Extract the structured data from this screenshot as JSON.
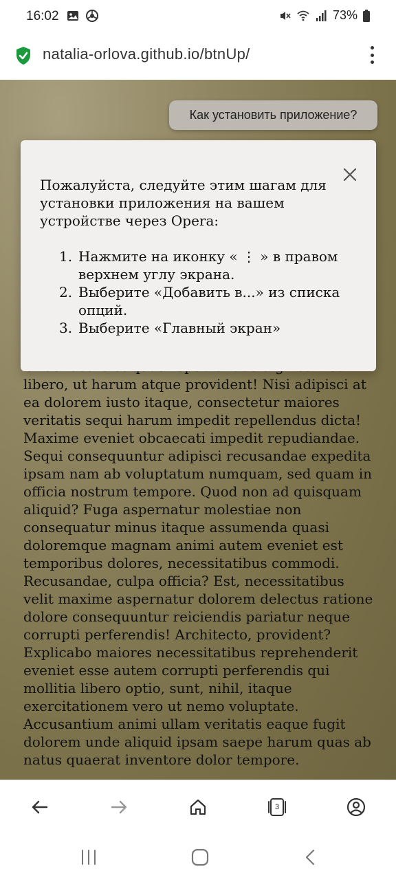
{
  "status_bar": {
    "time": "16:02",
    "battery": "73%",
    "icons_left": [
      "gallery-icon",
      "chrome-icon"
    ],
    "icons_right": [
      "mute-icon",
      "wifi-icon",
      "signal-icon",
      "battery-icon"
    ]
  },
  "address_bar": {
    "url": "natalia-orlova.github.io/btnUp/",
    "security_icon": "shield-check-icon",
    "menu_icon": "vertical-dots-icon"
  },
  "page": {
    "install_button_label": "Как установить приложение?",
    "body_text": "Unde facere et quae repudiandae dignissimos libero, ut harum atque provident! Nisi adipisci at ea dolorem iusto itaque, consectetur maiores veritatis sequi harum impedit repellendus dicta! Maxime eveniet obcaecati impedit repudiandae. Sequi consequuntur adipisci recusandae expedita ipsam nam ab voluptatum numquam, sed quam in officia nostrum tempore. Quod non ad quisquam aliquid? Fuga aspernatur molestiae non consequatur minus itaque assumenda quasi doloremque magnam animi autem eveniet est temporibus dolores, necessitatibus commodi. Recusandae, culpa officia? Est, necessitatibus velit maxime aspernatur dolorem delectus ratione dolore consequuntur reiciendis pariatur neque corrupti perferendis! Architecto, provident? Explicabo maiores necessitatibus reprehenderit eveniet esse autem corrupti perferendis qui mollitia libero optio, sunt, nihil, itaque exercitationem vero ut nemo voluptate. Accusantium animi ullam veritatis eaque fugit dolorem unde aliquid ipsam saepe harum quas ab natus quaerat inventore dolor tempore."
  },
  "dialog": {
    "intro": "Пожалуйста, следуйте этим шагам для установки приложения на вашем устройстве через Opera:",
    "steps": [
      {
        "num": "1.",
        "text": "Нажмите на иконку « ⋮ » в правом верхнем углу экрана."
      },
      {
        "num": "2.",
        "text": "Выберите «Добавить в...» из списка опций."
      },
      {
        "num": "3.",
        "text": "Выберите «Главный экран»"
      }
    ],
    "close_icon": "close-icon"
  },
  "bottom_nav": {
    "tabs_count": "3",
    "items": [
      "back-arrow-icon",
      "forward-arrow-icon",
      "home-icon",
      "tabs-icon",
      "account-icon"
    ]
  },
  "system_nav": {
    "items": [
      "recent-apps-icon",
      "home-button-icon",
      "back-icon"
    ]
  },
  "colors": {
    "page_background": "#8e8460",
    "dialog_background": "#f1f0ee",
    "install_button_background": "#bdb8b1",
    "shield": "#1a9a3c"
  }
}
